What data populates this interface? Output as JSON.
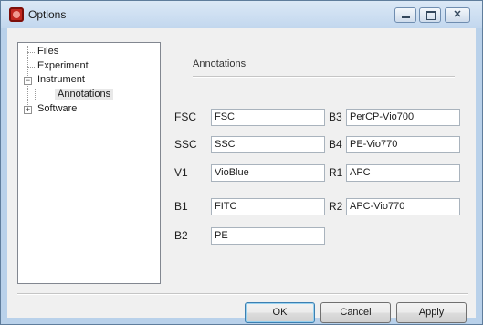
{
  "window": {
    "title": "Options",
    "app_icon": "flow-cytometer-app-icon"
  },
  "tree": {
    "nodes": [
      {
        "label": "Files"
      },
      {
        "label": "Experiment"
      },
      {
        "label": "Instrument",
        "expander": "−"
      },
      {
        "label": "Annotations",
        "selected": true
      },
      {
        "label": "Software",
        "expander": "+"
      }
    ]
  },
  "panel": {
    "title": "Annotations",
    "fields": [
      {
        "label": "FSC",
        "value": "FSC"
      },
      {
        "label": "SSC",
        "value": "SSC"
      },
      {
        "label": "V1",
        "value": "VioBlue"
      },
      {
        "label": "B1",
        "value": "FITC"
      },
      {
        "label": "B2",
        "value": "PE"
      },
      {
        "label": "B3",
        "value": "PerCP-Vio700"
      },
      {
        "label": "B4",
        "value": "PE-Vio770"
      },
      {
        "label": "R1",
        "value": "APC"
      },
      {
        "label": "R2",
        "value": "APC-Vio770"
      }
    ]
  },
  "buttons": {
    "ok": "OK",
    "cancel": "Cancel",
    "apply": "Apply"
  },
  "colors": {
    "title_bar": "#c9dcf0",
    "selection": "#e8e8e8",
    "app_icon": "#c2281f"
  }
}
